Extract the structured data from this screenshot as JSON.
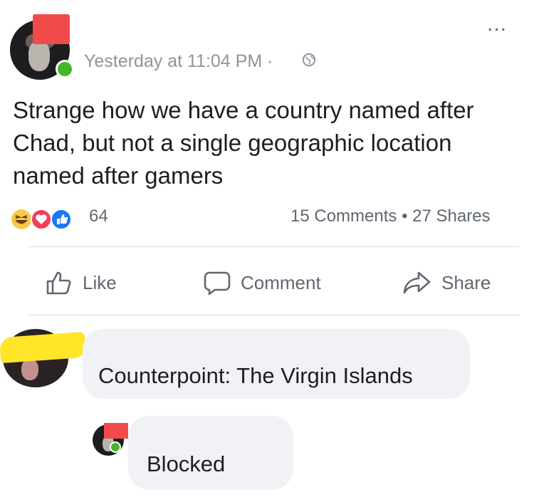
{
  "post": {
    "timestamp": "Yesterday at 11:04 PM",
    "separator": " · ",
    "privacy_icon": "globe-icon",
    "more_label": "...",
    "text": "Strange how we have a country named after Chad, but not a single geographic location named after gamers",
    "reactions": {
      "icons": [
        "haha-icon",
        "love-icon",
        "like-icon"
      ],
      "count": "64"
    },
    "comments_label": "15 Comments",
    "shares_label": "27 Shares"
  },
  "actions": {
    "like_label": "Like",
    "comment_label": "Comment",
    "share_label": "Share"
  },
  "comments": [
    {
      "text": "Counterpoint: The Virgin Islands"
    },
    {
      "text": "Blocked"
    }
  ],
  "colors": {
    "online": "#42b72a",
    "muted_text": "#606770",
    "bubble": "#f0f2f5",
    "redaction_red": "#f24a4a",
    "redaction_yellow": "#ffe629"
  }
}
